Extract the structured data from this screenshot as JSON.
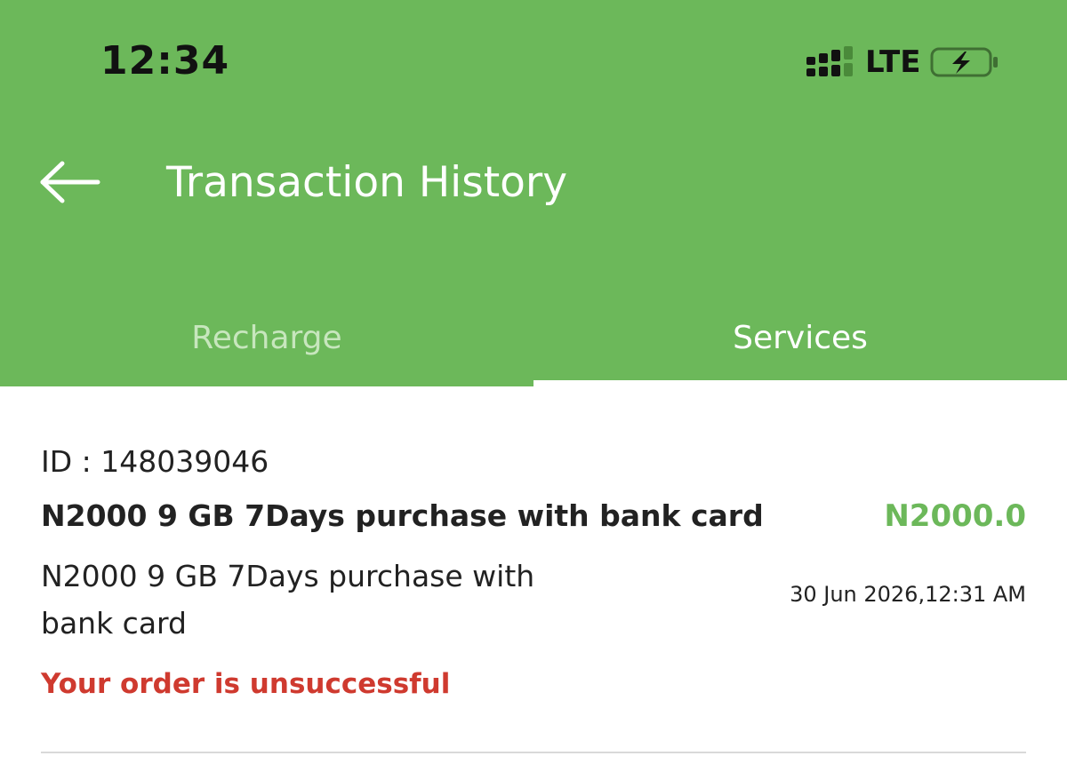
{
  "status_bar": {
    "time": "12:34",
    "network": "LTE",
    "icons": [
      "signal-icon",
      "battery-charging-icon"
    ]
  },
  "header": {
    "title": "Transaction History",
    "back_icon": "arrow-left-icon"
  },
  "tabs": [
    {
      "label": "Recharge",
      "active": false
    },
    {
      "label": "Services",
      "active": true
    }
  ],
  "transactions": [
    {
      "id": "ID : 148039046",
      "name": "N2000 9 GB 7Days purchase with bank card",
      "amount": "N2000.0",
      "description": "N2000 9 GB 7Days purchase with bank card",
      "datetime": "30 Jun 2026,12:31 AM",
      "status": "Your order is unsuccessful"
    }
  ],
  "colors": {
    "brand_green": "#6cb85a",
    "inactive_tab": "#c7e6bd",
    "error_red": "#cf3a2f",
    "text_dark": "#222222"
  }
}
